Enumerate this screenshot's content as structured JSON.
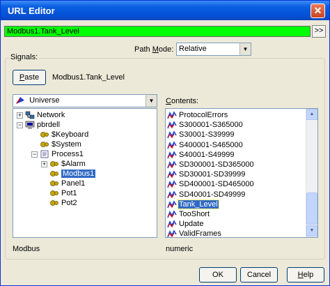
{
  "window": {
    "title": "URL Editor",
    "close_glyph": "✕"
  },
  "url": {
    "value": "Modbus1.Tank_Level",
    "more_label": ">>"
  },
  "path_mode": {
    "label": "Path Mode:",
    "selected": "Relative"
  },
  "signals": {
    "group_label": "Signals:",
    "paste_label": "Paste",
    "current_signal": "Modbus1.Tank_Level"
  },
  "universe": {
    "selected": "Universe"
  },
  "tree": {
    "items": [
      {
        "label": "Network",
        "icon": "network-icon"
      },
      {
        "label": "pbrdell",
        "icon": "computer-icon"
      },
      {
        "label": "$Keyboard",
        "icon": "gear-icon"
      },
      {
        "label": "$System",
        "icon": "gear-icon"
      },
      {
        "label": "Process1",
        "icon": "process-icon"
      },
      {
        "label": "$Alarm",
        "icon": "gear-icon"
      },
      {
        "label": "Modbus1",
        "icon": "gear-icon"
      },
      {
        "label": "Panel1",
        "icon": "gear-icon"
      },
      {
        "label": "Pot1",
        "icon": "gear-icon"
      },
      {
        "label": "Pot2",
        "icon": "gear-icon"
      }
    ],
    "status": "Modbus"
  },
  "contents": {
    "label": "Contents:",
    "items": [
      "ProtocolErrors",
      "S300001-S365000",
      "S30001-S39999",
      "S400001-S465000",
      "S40001-S49999",
      "SD300001-SD365000",
      "SD30001-SD39999",
      "SD400001-SD465000",
      "SD40001-SD49999",
      "Tank_Level",
      "TooShort",
      "Update",
      "ValidFrames"
    ],
    "selected_index": 9,
    "status": "numeric"
  },
  "buttons": {
    "ok": "OK",
    "cancel": "Cancel",
    "help": "Help"
  },
  "colors": {
    "url_background": "#00ff00",
    "selection": "#316ac5",
    "titlebar": "#0453d8"
  }
}
